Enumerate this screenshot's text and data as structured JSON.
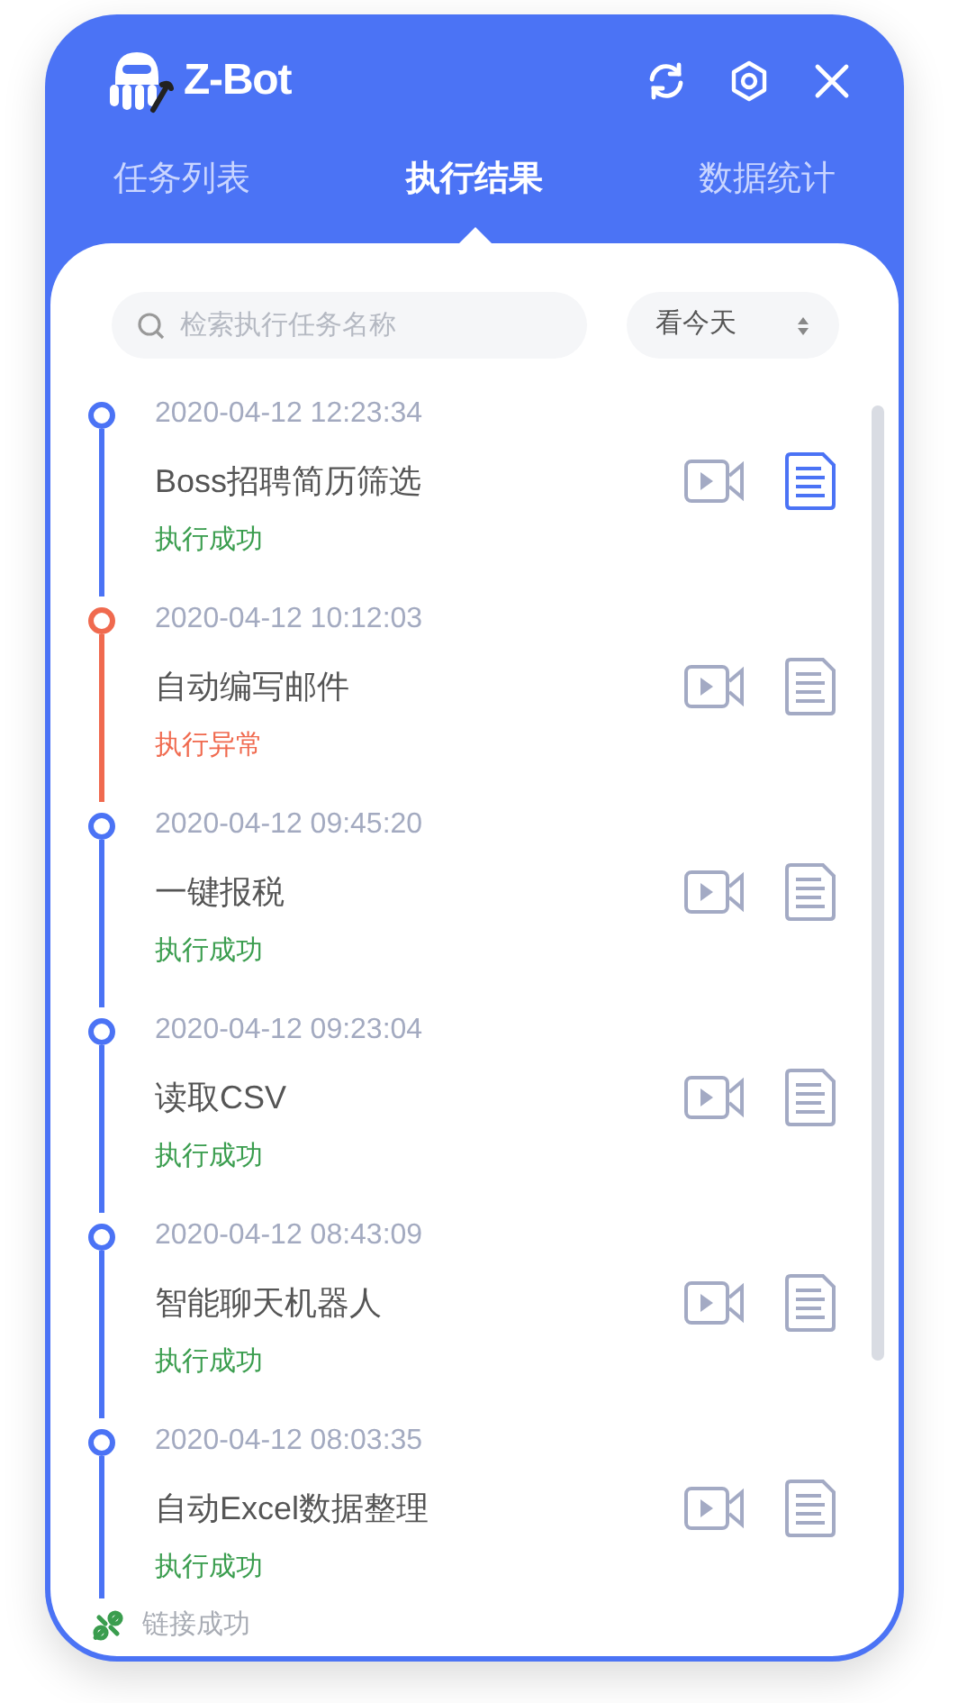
{
  "app": {
    "title": "Z-Bot"
  },
  "tabs": [
    {
      "label": "任务列表",
      "selected": false
    },
    {
      "label": "执行结果",
      "selected": true
    },
    {
      "label": "数据统计",
      "selected": false
    }
  ],
  "search": {
    "placeholder": "检索执行任务名称"
  },
  "filter": {
    "value": "看今天"
  },
  "results": [
    {
      "time": "2020-04-12 12:23:34",
      "name": "Boss招聘简历筛选",
      "status": "执行成功",
      "kind": "success",
      "selected": true
    },
    {
      "time": "2020-04-12 10:12:03",
      "name": "自动编写邮件",
      "status": "执行异常",
      "kind": "error",
      "selected": false
    },
    {
      "time": "2020-04-12 09:45:20",
      "name": "一键报税",
      "status": "执行成功",
      "kind": "success",
      "selected": false
    },
    {
      "time": "2020-04-12 09:23:04",
      "name": "读取CSV",
      "status": "执行成功",
      "kind": "success",
      "selected": false
    },
    {
      "time": "2020-04-12 08:43:09",
      "name": "智能聊天机器人",
      "status": "执行成功",
      "kind": "success",
      "selected": false
    },
    {
      "time": "2020-04-12 08:03:35",
      "name": "自动Excel数据整理",
      "status": "执行成功",
      "kind": "success",
      "selected": false
    }
  ],
  "status_bar": {
    "text": "链接成功"
  }
}
